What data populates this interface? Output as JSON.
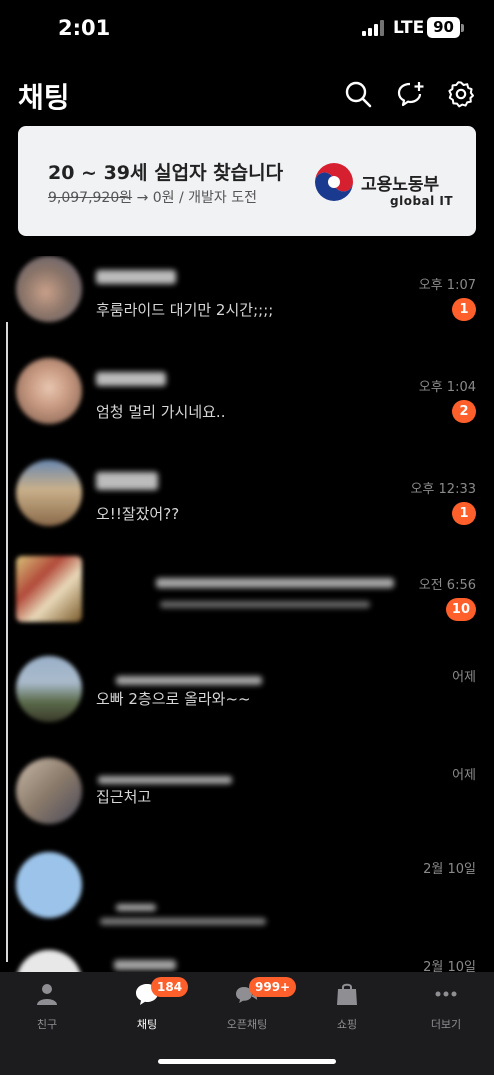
{
  "status": {
    "time": "2:01",
    "network": "LTE",
    "battery": "90"
  },
  "header": {
    "title": "채팅",
    "icons": [
      "search-icon",
      "new-chat-icon",
      "settings-icon"
    ]
  },
  "ad": {
    "title": "20 ~ 39세 실업자 찾습니다",
    "old_price": "9,097,920원",
    "rest": " → 0원 / 개발자 도전",
    "org": "고용노동부",
    "brand": "global IT"
  },
  "chats": [
    {
      "time": "오후 1:07",
      "preview": "후룸라이드 대기만 2시간;;;;",
      "badge": "1"
    },
    {
      "time": "오후 1:04",
      "preview": "엄청 멀리 가시네요..",
      "badge": "2"
    },
    {
      "time": "오후 12:33",
      "preview": "오!!잘잤어??",
      "badge": "1"
    },
    {
      "time": "오전 6:56",
      "preview": "",
      "badge": "10"
    },
    {
      "time": "어제",
      "preview": "오빠 2층으로 올라와~~",
      "badge": ""
    },
    {
      "time": "어제",
      "preview": "집근처고",
      "badge": ""
    },
    {
      "time": "2월 10일",
      "preview": "",
      "badge": ""
    },
    {
      "time": "2월 10일",
      "preview": "",
      "badge": ""
    }
  ],
  "tabs": [
    {
      "label": "친구",
      "icon": "person-icon",
      "badge": ""
    },
    {
      "label": "채팅",
      "icon": "chat-bubble-icon",
      "badge": "184"
    },
    {
      "label": "오픈채팅",
      "icon": "open-chat-icon",
      "badge": "999+"
    },
    {
      "label": "쇼핑",
      "icon": "shopping-bag-icon",
      "badge": ""
    },
    {
      "label": "더보기",
      "icon": "more-icon",
      "badge": ""
    }
  ],
  "colors": {
    "badge": "#ff5f2b",
    "tab_bar": "#1c1c1e",
    "banner_bg": "#f1f2f4"
  }
}
